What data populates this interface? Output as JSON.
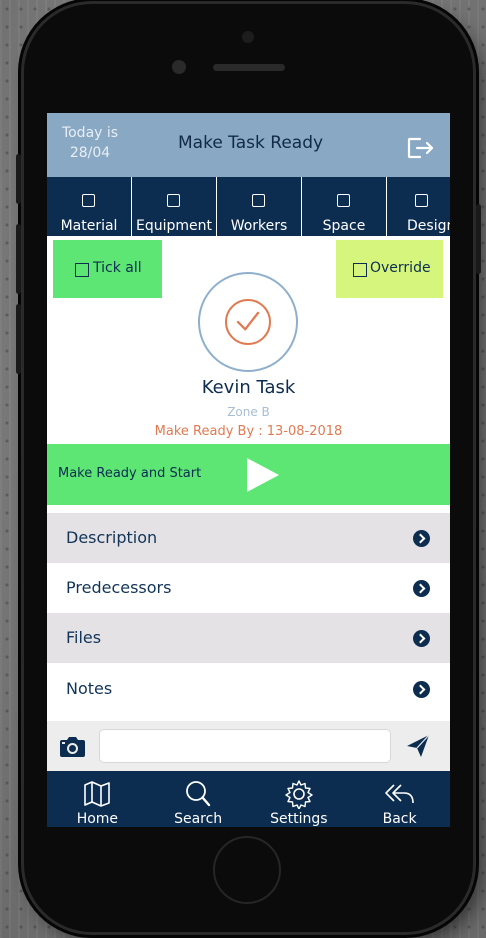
{
  "header": {
    "today_line1": "Today is",
    "today_date": "28/04",
    "title": "Make Task Ready"
  },
  "categories": [
    {
      "label": "Material"
    },
    {
      "label": "Equipment"
    },
    {
      "label": "Workers"
    },
    {
      "label": "Space"
    },
    {
      "label": "Design"
    }
  ],
  "controls": {
    "tick_all": "Tick all",
    "override": "Override"
  },
  "task": {
    "name": "Kevin Task",
    "zone": "Zone B",
    "ready_by": "Make Ready By : 13-08-2018"
  },
  "start": {
    "label": "Make Ready and Start"
  },
  "sections": [
    {
      "label": "Description"
    },
    {
      "label": "Predecessors"
    },
    {
      "label": "Files"
    },
    {
      "label": "Notes"
    }
  ],
  "message": {
    "value": "",
    "placeholder": ""
  },
  "nav": [
    {
      "label": "Home",
      "icon": "map-icon"
    },
    {
      "label": "Search",
      "icon": "search-icon"
    },
    {
      "label": "Settings",
      "icon": "gear-icon"
    },
    {
      "label": "Back",
      "icon": "reply-all-icon"
    }
  ],
  "colors": {
    "header": "#89a8c4",
    "navy": "#0c2d50",
    "green": "#5ee675",
    "lime": "#d5f57c",
    "accent": "#e07a52"
  }
}
